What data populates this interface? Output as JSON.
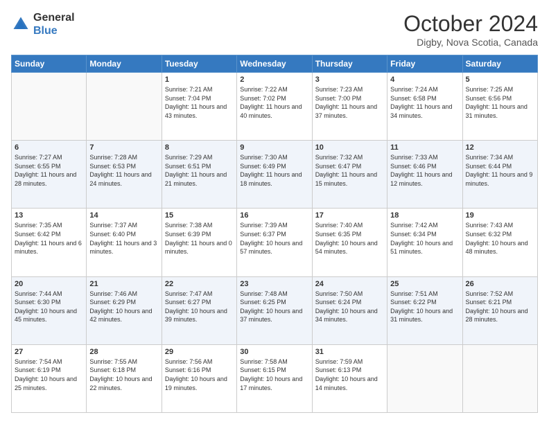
{
  "header": {
    "logo_general": "General",
    "logo_blue": "Blue",
    "month_title": "October 2024",
    "location": "Digby, Nova Scotia, Canada"
  },
  "weekdays": [
    "Sunday",
    "Monday",
    "Tuesday",
    "Wednesday",
    "Thursday",
    "Friday",
    "Saturday"
  ],
  "weeks": [
    [
      {
        "num": "",
        "empty": true
      },
      {
        "num": "",
        "empty": true
      },
      {
        "num": "1",
        "sunrise": "Sunrise: 7:21 AM",
        "sunset": "Sunset: 7:04 PM",
        "daylight": "Daylight: 11 hours and 43 minutes."
      },
      {
        "num": "2",
        "sunrise": "Sunrise: 7:22 AM",
        "sunset": "Sunset: 7:02 PM",
        "daylight": "Daylight: 11 hours and 40 minutes."
      },
      {
        "num": "3",
        "sunrise": "Sunrise: 7:23 AM",
        "sunset": "Sunset: 7:00 PM",
        "daylight": "Daylight: 11 hours and 37 minutes."
      },
      {
        "num": "4",
        "sunrise": "Sunrise: 7:24 AM",
        "sunset": "Sunset: 6:58 PM",
        "daylight": "Daylight: 11 hours and 34 minutes."
      },
      {
        "num": "5",
        "sunrise": "Sunrise: 7:25 AM",
        "sunset": "Sunset: 6:56 PM",
        "daylight": "Daylight: 11 hours and 31 minutes."
      }
    ],
    [
      {
        "num": "6",
        "sunrise": "Sunrise: 7:27 AM",
        "sunset": "Sunset: 6:55 PM",
        "daylight": "Daylight: 11 hours and 28 minutes."
      },
      {
        "num": "7",
        "sunrise": "Sunrise: 7:28 AM",
        "sunset": "Sunset: 6:53 PM",
        "daylight": "Daylight: 11 hours and 24 minutes."
      },
      {
        "num": "8",
        "sunrise": "Sunrise: 7:29 AM",
        "sunset": "Sunset: 6:51 PM",
        "daylight": "Daylight: 11 hours and 21 minutes."
      },
      {
        "num": "9",
        "sunrise": "Sunrise: 7:30 AM",
        "sunset": "Sunset: 6:49 PM",
        "daylight": "Daylight: 11 hours and 18 minutes."
      },
      {
        "num": "10",
        "sunrise": "Sunrise: 7:32 AM",
        "sunset": "Sunset: 6:47 PM",
        "daylight": "Daylight: 11 hours and 15 minutes."
      },
      {
        "num": "11",
        "sunrise": "Sunrise: 7:33 AM",
        "sunset": "Sunset: 6:46 PM",
        "daylight": "Daylight: 11 hours and 12 minutes."
      },
      {
        "num": "12",
        "sunrise": "Sunrise: 7:34 AM",
        "sunset": "Sunset: 6:44 PM",
        "daylight": "Daylight: 11 hours and 9 minutes."
      }
    ],
    [
      {
        "num": "13",
        "sunrise": "Sunrise: 7:35 AM",
        "sunset": "Sunset: 6:42 PM",
        "daylight": "Daylight: 11 hours and 6 minutes."
      },
      {
        "num": "14",
        "sunrise": "Sunrise: 7:37 AM",
        "sunset": "Sunset: 6:40 PM",
        "daylight": "Daylight: 11 hours and 3 minutes."
      },
      {
        "num": "15",
        "sunrise": "Sunrise: 7:38 AM",
        "sunset": "Sunset: 6:39 PM",
        "daylight": "Daylight: 11 hours and 0 minutes."
      },
      {
        "num": "16",
        "sunrise": "Sunrise: 7:39 AM",
        "sunset": "Sunset: 6:37 PM",
        "daylight": "Daylight: 10 hours and 57 minutes."
      },
      {
        "num": "17",
        "sunrise": "Sunrise: 7:40 AM",
        "sunset": "Sunset: 6:35 PM",
        "daylight": "Daylight: 10 hours and 54 minutes."
      },
      {
        "num": "18",
        "sunrise": "Sunrise: 7:42 AM",
        "sunset": "Sunset: 6:34 PM",
        "daylight": "Daylight: 10 hours and 51 minutes."
      },
      {
        "num": "19",
        "sunrise": "Sunrise: 7:43 AM",
        "sunset": "Sunset: 6:32 PM",
        "daylight": "Daylight: 10 hours and 48 minutes."
      }
    ],
    [
      {
        "num": "20",
        "sunrise": "Sunrise: 7:44 AM",
        "sunset": "Sunset: 6:30 PM",
        "daylight": "Daylight: 10 hours and 45 minutes."
      },
      {
        "num": "21",
        "sunrise": "Sunrise: 7:46 AM",
        "sunset": "Sunset: 6:29 PM",
        "daylight": "Daylight: 10 hours and 42 minutes."
      },
      {
        "num": "22",
        "sunrise": "Sunrise: 7:47 AM",
        "sunset": "Sunset: 6:27 PM",
        "daylight": "Daylight: 10 hours and 39 minutes."
      },
      {
        "num": "23",
        "sunrise": "Sunrise: 7:48 AM",
        "sunset": "Sunset: 6:25 PM",
        "daylight": "Daylight: 10 hours and 37 minutes."
      },
      {
        "num": "24",
        "sunrise": "Sunrise: 7:50 AM",
        "sunset": "Sunset: 6:24 PM",
        "daylight": "Daylight: 10 hours and 34 minutes."
      },
      {
        "num": "25",
        "sunrise": "Sunrise: 7:51 AM",
        "sunset": "Sunset: 6:22 PM",
        "daylight": "Daylight: 10 hours and 31 minutes."
      },
      {
        "num": "26",
        "sunrise": "Sunrise: 7:52 AM",
        "sunset": "Sunset: 6:21 PM",
        "daylight": "Daylight: 10 hours and 28 minutes."
      }
    ],
    [
      {
        "num": "27",
        "sunrise": "Sunrise: 7:54 AM",
        "sunset": "Sunset: 6:19 PM",
        "daylight": "Daylight: 10 hours and 25 minutes."
      },
      {
        "num": "28",
        "sunrise": "Sunrise: 7:55 AM",
        "sunset": "Sunset: 6:18 PM",
        "daylight": "Daylight: 10 hours and 22 minutes."
      },
      {
        "num": "29",
        "sunrise": "Sunrise: 7:56 AM",
        "sunset": "Sunset: 6:16 PM",
        "daylight": "Daylight: 10 hours and 19 minutes."
      },
      {
        "num": "30",
        "sunrise": "Sunrise: 7:58 AM",
        "sunset": "Sunset: 6:15 PM",
        "daylight": "Daylight: 10 hours and 17 minutes."
      },
      {
        "num": "31",
        "sunrise": "Sunrise: 7:59 AM",
        "sunset": "Sunset: 6:13 PM",
        "daylight": "Daylight: 10 hours and 14 minutes."
      },
      {
        "num": "",
        "empty": true
      },
      {
        "num": "",
        "empty": true
      }
    ]
  ]
}
